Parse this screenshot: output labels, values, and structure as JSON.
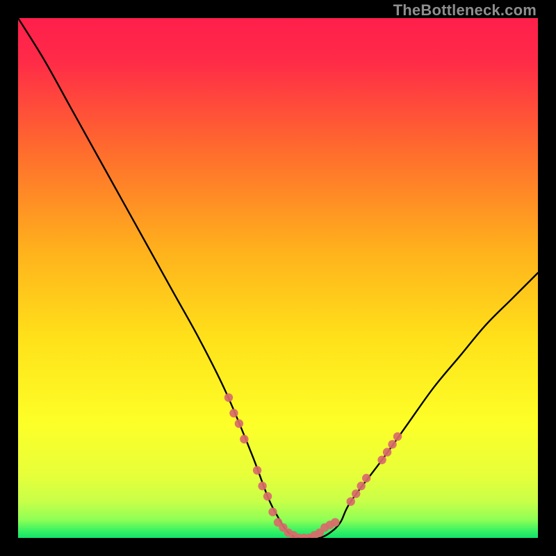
{
  "watermark": {
    "text": "TheBottleneck.com"
  },
  "chart_data": {
    "type": "line",
    "title": "",
    "xlabel": "",
    "ylabel": "",
    "xlim": [
      0,
      100
    ],
    "ylim": [
      0,
      100
    ],
    "grid": false,
    "legend": false,
    "background_gradient": {
      "top_color": "#ff1f4b",
      "mid_colors": [
        "#ff7a2a",
        "#ffd21e",
        "#f6ff2a"
      ],
      "bottom_color": "#11e46a"
    },
    "series": [
      {
        "name": "bottleneck-curve",
        "color": "#000000",
        "x": [
          0,
          5,
          10,
          15,
          20,
          25,
          30,
          35,
          40,
          45,
          48,
          50,
          52,
          54,
          56,
          58,
          60,
          62,
          64,
          70,
          75,
          80,
          85,
          90,
          95,
          100
        ],
        "y": [
          100,
          92,
          83,
          74,
          65,
          56,
          47,
          38,
          28,
          16,
          8,
          4,
          1,
          0,
          0,
          0,
          1,
          3,
          7,
          15,
          22,
          29,
          35,
          41,
          46,
          51
        ]
      }
    ],
    "markers": {
      "name": "highlight-dots",
      "color": "#d96a6a",
      "points": [
        {
          "x": 40.5,
          "y": 27
        },
        {
          "x": 41.5,
          "y": 24
        },
        {
          "x": 42.5,
          "y": 22
        },
        {
          "x": 43.5,
          "y": 19
        },
        {
          "x": 46.0,
          "y": 13
        },
        {
          "x": 47.0,
          "y": 10
        },
        {
          "x": 48.0,
          "y": 8
        },
        {
          "x": 49.0,
          "y": 5
        },
        {
          "x": 50.0,
          "y": 3
        },
        {
          "x": 51.0,
          "y": 2
        },
        {
          "x": 52.0,
          "y": 1
        },
        {
          "x": 53.0,
          "y": 0.5
        },
        {
          "x": 54.0,
          "y": 0
        },
        {
          "x": 55.0,
          "y": 0
        },
        {
          "x": 56.0,
          "y": 0
        },
        {
          "x": 57.0,
          "y": 0.5
        },
        {
          "x": 58.0,
          "y": 1
        },
        {
          "x": 59.0,
          "y": 2
        },
        {
          "x": 60.0,
          "y": 2.5
        },
        {
          "x": 61.0,
          "y": 3
        },
        {
          "x": 64.0,
          "y": 7
        },
        {
          "x": 65.0,
          "y": 8.5
        },
        {
          "x": 66.0,
          "y": 10
        },
        {
          "x": 67.0,
          "y": 11.5
        },
        {
          "x": 70.0,
          "y": 15
        },
        {
          "x": 71.0,
          "y": 16.5
        },
        {
          "x": 72.0,
          "y": 18
        },
        {
          "x": 73.0,
          "y": 19.5
        }
      ]
    }
  }
}
